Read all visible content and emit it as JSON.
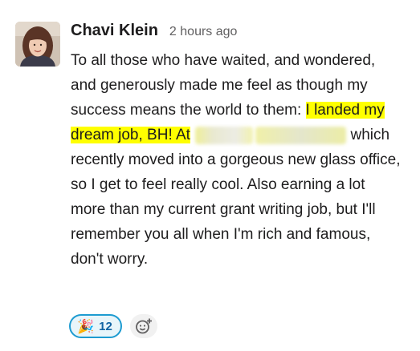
{
  "message": {
    "author": "Chavi Klein",
    "timestamp": "2 hours ago",
    "text_part1": "To all those who have waited, and wondered, and generously made me feel as though my success means the world to them: ",
    "highlighted_text": "I landed my dream job, BH! At",
    "text_part2": " which recently moved into a gorgeous new glass office, so I get to feel really cool. Also earning a lot more than my current grant writing job, but I'll remember you all when I'm rich and famous, don't worry."
  },
  "reactions": [
    {
      "emoji": "🎉",
      "icon": "party-popper-icon",
      "count": "12"
    }
  ],
  "add_reaction_icon": "add-emoji-icon",
  "colors": {
    "highlight": "#ffff00",
    "reaction_border": "#1d9bd1",
    "reaction_bg": "#e8f5fa",
    "reaction_count": "#1264a3"
  }
}
